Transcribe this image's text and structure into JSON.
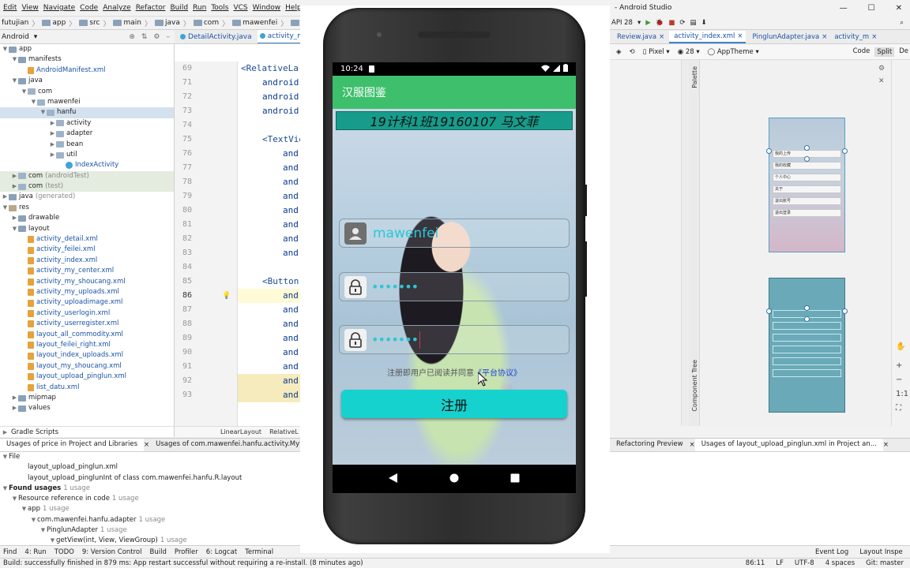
{
  "menubar": {
    "items": [
      "Edit",
      "View",
      "Navigate",
      "Code",
      "Analyze",
      "Refactor",
      "Build",
      "Run",
      "Tools",
      "VCS",
      "Window",
      "Help"
    ]
  },
  "navbar": {
    "crumbs": [
      "futujian",
      "app",
      "src",
      "main",
      "java",
      "com",
      "mawenfei",
      "hanfu"
    ]
  },
  "project_panel": {
    "view": "Android",
    "tree": [
      {
        "label": "app",
        "indent": 0,
        "icon": "folder",
        "arrow": "down"
      },
      {
        "label": "manifests",
        "indent": 1,
        "icon": "folder",
        "arrow": "down"
      },
      {
        "label": "AndroidManifest.xml",
        "indent": 2,
        "icon": "xml",
        "arrow": "",
        "cls": "blue"
      },
      {
        "label": "java",
        "indent": 1,
        "icon": "folder",
        "arrow": "down"
      },
      {
        "label": "com",
        "indent": 2,
        "icon": "pkg",
        "arrow": "down"
      },
      {
        "label": "mawenfei",
        "indent": 3,
        "icon": "pkg",
        "arrow": "down"
      },
      {
        "label": "hanfu",
        "indent": 4,
        "icon": "pkg",
        "arrow": "down",
        "sel": true
      },
      {
        "label": "activity",
        "indent": 5,
        "icon": "pkg",
        "arrow": "right"
      },
      {
        "label": "adapter",
        "indent": 5,
        "icon": "pkg",
        "arrow": "right"
      },
      {
        "label": "bean",
        "indent": 5,
        "icon": "pkg",
        "arrow": "right"
      },
      {
        "label": "util",
        "indent": 5,
        "icon": "pkg",
        "arrow": "right"
      },
      {
        "label": "IndexActivity",
        "indent": 6,
        "icon": "cls",
        "arrow": "",
        "cls": "blue"
      },
      {
        "label": "com",
        "suffix": "(androidTest)",
        "indent": 1,
        "icon": "pkg",
        "arrow": "right",
        "hl": true
      },
      {
        "label": "com",
        "suffix": "(test)",
        "indent": 1,
        "icon": "pkg",
        "arrow": "right",
        "hl": true
      },
      {
        "label": "java",
        "suffix": "(generated)",
        "indent": 0,
        "icon": "folder",
        "arrow": "right"
      },
      {
        "label": "res",
        "indent": 0,
        "icon": "res",
        "arrow": "down"
      },
      {
        "label": "drawable",
        "indent": 1,
        "icon": "folder",
        "arrow": "right"
      },
      {
        "label": "layout",
        "indent": 1,
        "icon": "folder",
        "arrow": "down"
      },
      {
        "label": "activity_detail.xml",
        "indent": 2,
        "icon": "xml",
        "arrow": "",
        "cls": "blue"
      },
      {
        "label": "activity_feilei.xml",
        "indent": 2,
        "icon": "xml",
        "arrow": "",
        "cls": "blue"
      },
      {
        "label": "activity_index.xml",
        "indent": 2,
        "icon": "xml",
        "arrow": "",
        "cls": "blue"
      },
      {
        "label": "activity_my_center.xml",
        "indent": 2,
        "icon": "xml",
        "arrow": "",
        "cls": "blue"
      },
      {
        "label": "activity_my_shoucang.xml",
        "indent": 2,
        "icon": "xml",
        "arrow": "",
        "cls": "blue"
      },
      {
        "label": "activity_my_uploads.xml",
        "indent": 2,
        "icon": "xml",
        "arrow": "",
        "cls": "blue"
      },
      {
        "label": "activity_uploadimage.xml",
        "indent": 2,
        "icon": "xml",
        "arrow": "",
        "cls": "blue"
      },
      {
        "label": "activity_userlogin.xml",
        "indent": 2,
        "icon": "xml",
        "arrow": "",
        "cls": "blue"
      },
      {
        "label": "activity_userregister.xml",
        "indent": 2,
        "icon": "xml",
        "arrow": "",
        "cls": "blue"
      },
      {
        "label": "layout_all_commodity.xml",
        "indent": 2,
        "icon": "xml",
        "arrow": "",
        "cls": "blue"
      },
      {
        "label": "layout_feilei_right.xml",
        "indent": 2,
        "icon": "xml",
        "arrow": "",
        "cls": "blue"
      },
      {
        "label": "layout_index_uploads.xml",
        "indent": 2,
        "icon": "xml",
        "arrow": "",
        "cls": "blue"
      },
      {
        "label": "layout_my_shoucang.xml",
        "indent": 2,
        "icon": "xml",
        "arrow": "",
        "cls": "blue"
      },
      {
        "label": "layout_upload_pinglun.xml",
        "indent": 2,
        "icon": "xml",
        "arrow": "",
        "cls": "blue"
      },
      {
        "label": "list_datu.xml",
        "indent": 2,
        "icon": "xml",
        "arrow": "",
        "cls": "blue"
      },
      {
        "label": "mipmap",
        "indent": 1,
        "icon": "folder",
        "arrow": "right"
      },
      {
        "label": "values",
        "indent": 1,
        "icon": "folder",
        "arrow": "right"
      }
    ],
    "footer": "Gradle Scripts"
  },
  "editor": {
    "tabs": [
      "DetailActivity.java",
      "activity_my"
    ],
    "line_numbers": [
      "69",
      "71",
      "72",
      "73",
      "74",
      "75",
      "76",
      "77",
      "78",
      "79",
      "80",
      "81",
      "82",
      "83",
      "84",
      "85",
      "86",
      "87",
      "88",
      "89",
      "90",
      "91",
      "92",
      "93"
    ],
    "lines": [
      "<RelativeLa",
      "android",
      "android",
      "android",
      "",
      "<TextVie",
      "and",
      "and",
      "and",
      "and",
      "and",
      "and",
      "and",
      "and",
      "",
      "<Button",
      "and",
      "and",
      "and",
      "and",
      "and",
      "and",
      "and",
      "and"
    ],
    "breadcrumb": [
      "LinearLayout",
      "RelativeL"
    ]
  },
  "find_panel": {
    "tabs": [
      "Usages of price in Project and Libraries",
      "Usages of com.mawenfei.hanfu.activity.MyI..."
    ],
    "rows": [
      {
        "text": "File",
        "indent": 0,
        "arrow": "down"
      },
      {
        "text": "layout_upload_pinglun.xml",
        "indent": 2,
        "arrow": ""
      },
      {
        "text": "layout_upload_pinglunInt of class com.mawenfei.hanfu.R.layout",
        "indent": 2,
        "arrow": ""
      },
      {
        "text": "Found usages",
        "suffix": "1 usage",
        "indent": 0,
        "arrow": "down",
        "bold": true
      },
      {
        "text": "Resource reference in code",
        "suffix": "1 usage",
        "indent": 1,
        "arrow": "down"
      },
      {
        "text": "app",
        "suffix": "1 usage",
        "indent": 2,
        "arrow": "down"
      },
      {
        "text": "com.mawenfei.hanfu.adapter",
        "suffix": "1 usage",
        "indent": 3,
        "arrow": "down"
      },
      {
        "text": "PinglunAdapter",
        "suffix": "1 usage",
        "indent": 4,
        "arrow": "down"
      },
      {
        "text": "getView(int, View, ViewGroup)",
        "suffix": "1 usage",
        "indent": 5,
        "arrow": "down"
      }
    ]
  },
  "bottom_tools": [
    "Find",
    "4: Run",
    "TODO",
    "9: Version Control",
    "Build",
    "Profiler",
    "6: Logcat",
    "Terminal"
  ],
  "status": {
    "message": "Build: successfully finished in 879 ms: App restart successful without requiring a re-install. (8 minutes ago)",
    "position": "86:11",
    "line_sep": "LF",
    "encoding": "UTF-8",
    "indent": "4 spaces",
    "git": "Git: master"
  },
  "phone": {
    "time": "10:24",
    "app_title": "汉服图鉴",
    "banner": "19计科1班19160107 马文菲",
    "username": "mawenfei",
    "password_mask": "•••••••",
    "confirm_mask": "•••••••",
    "agree_text": "注册即用户已阅读并同意",
    "agree_link": "《平台协议》",
    "register_button": "注册"
  },
  "right_panel": {
    "title": "- Android Studio",
    "api": "API 28",
    "tabs": [
      "Review.java",
      "activity_index.xml",
      "PinglunAdapter.java",
      "activity_m"
    ],
    "design_toolbar": {
      "device": "Pixel",
      "api": "28",
      "theme": "AppTheme"
    },
    "modes": [
      "Code",
      "Split",
      "De"
    ],
    "side_labels": [
      "Palette",
      "Component Tree"
    ],
    "preview_rows": [
      "我的上传",
      "我的收藏",
      "个人中心",
      "关于",
      "退出账号",
      "退出登录"
    ],
    "find_tabs": [
      "Refactoring Preview",
      "Usages of layout_upload_pinglun.xml in Project an..."
    ],
    "bottom_tools": [
      "Event Log",
      "Layout Inspe"
    ]
  },
  "colors": {
    "appbar": "#3dbf6c",
    "button": "#16d2ce",
    "banner": "#179c8c",
    "link": "#1f3fd8",
    "input_text": "#2cc6d6"
  }
}
